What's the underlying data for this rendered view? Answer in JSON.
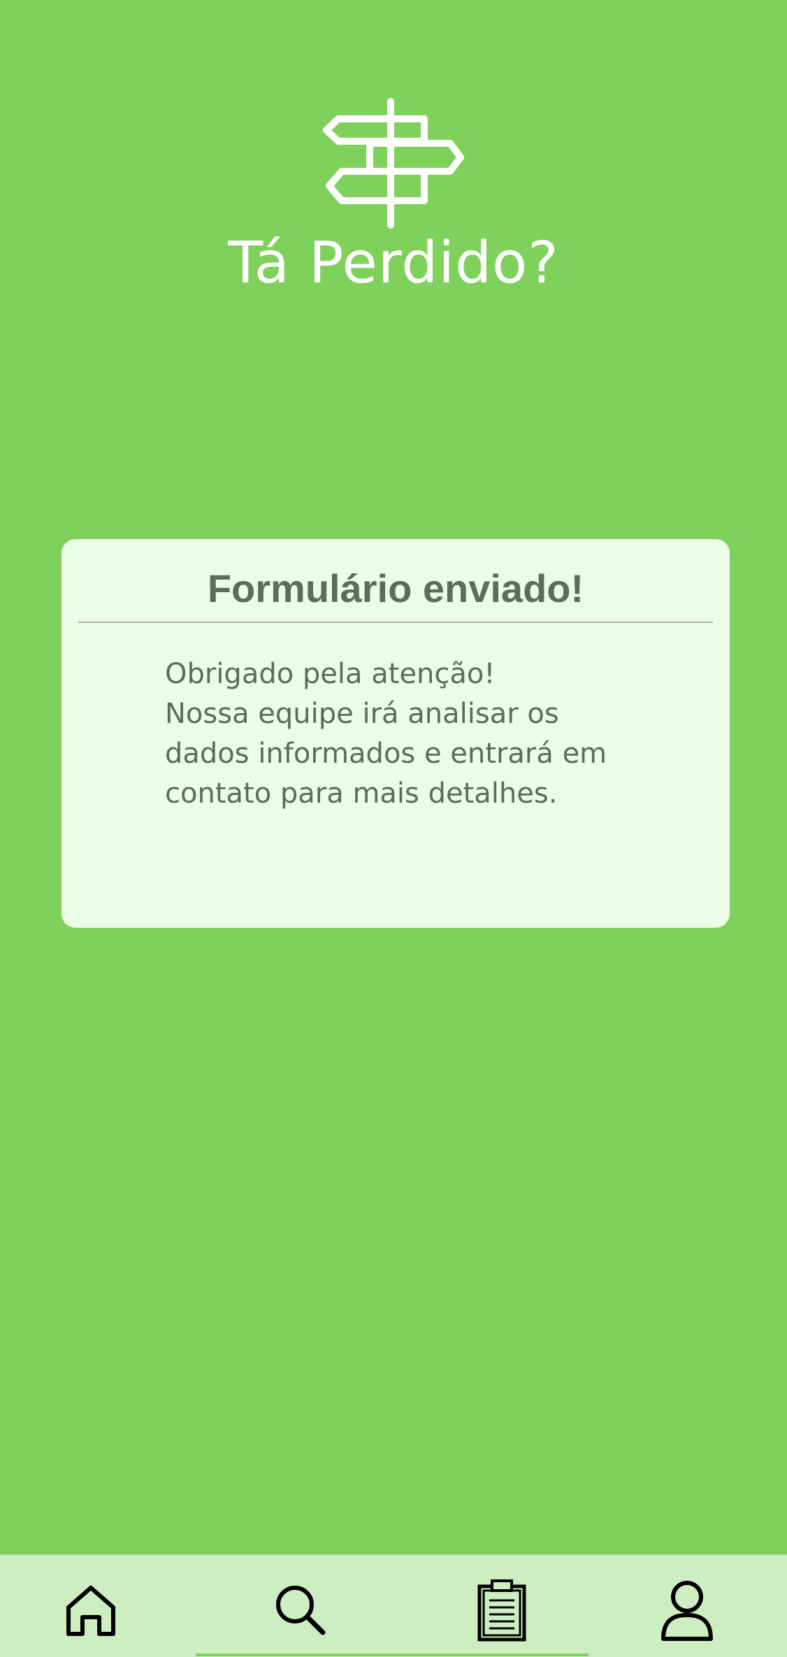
{
  "header": {
    "app_title": "Tá Perdido?",
    "logo_icon": "signpost-icon"
  },
  "confirmation_card": {
    "title": "Formulário enviado!",
    "message": "Obrigado pela atenção!\nNossa equipe irá analisar os dados informados e entrará em contato para mais detalhes."
  },
  "bottom_nav": {
    "items": [
      {
        "icon": "home-icon"
      },
      {
        "icon": "search-icon"
      },
      {
        "icon": "clipboard-icon"
      },
      {
        "icon": "user-icon"
      }
    ],
    "active_index": 1
  },
  "colors": {
    "background": "#7ed25c",
    "card_background": "#ecfde8",
    "card_text": "#5d6e57",
    "nav_background": "#cdeec1",
    "title_text": "#ffffff"
  }
}
